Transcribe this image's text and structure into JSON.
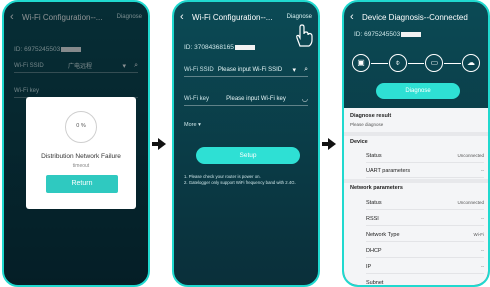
{
  "colors": {
    "accent": "#2ee0d4",
    "frame": "#20d9cf",
    "bg_dark": "#0a2f3a",
    "panel": "#f4f5f7"
  },
  "screen1": {
    "title": "Wi-Fi Configuration--...",
    "diagnose": "Diagnose",
    "device_id": "ID: 6975245503",
    "ssid_label": "Wi-Fi SSID",
    "ssid_value": "广电远程",
    "wifi_key_label": "Wi-Fi key",
    "modal": {
      "percent": "0 %",
      "message": "Distribution Network Failure",
      "sub": "timeout",
      "button": "Return"
    }
  },
  "screen2": {
    "title": "Wi-Fi Configuration--...",
    "diagnose": "Diagnose",
    "device_id": "ID: 37084368165",
    "ssid_label": "Wi-Fi SSID",
    "ssid_placeholder": "Please input Wi-Fi SSID",
    "key_label": "Wi-Fi key",
    "key_placeholder": "Please input Wi-Fi key",
    "more": "More",
    "setup": "Setup",
    "notes": [
      "1. Please check your router is power on.",
      "2. Gatelogger only support WiFi frequency band with 2.4G."
    ]
  },
  "screen3": {
    "title": "Device Diagnosis--Connected",
    "device_id": "ID: 6975245503",
    "diagnose_button": "Diagnose",
    "result_title": "Diagnose result",
    "result_sub": "Please diagnose",
    "device_section": "Device",
    "device_rows": [
      {
        "label": "Status",
        "value": "Unconnected"
      },
      {
        "label": "UART parameters",
        "value": "--"
      }
    ],
    "network_section": "Network parameters",
    "network_rows": [
      {
        "label": "Status",
        "value": "Unconnected"
      },
      {
        "label": "RSSI",
        "value": "--"
      },
      {
        "label": "Network Type",
        "value": "Wi-Fi"
      },
      {
        "label": "DHCP",
        "value": "--"
      },
      {
        "label": "IP",
        "value": "--"
      },
      {
        "label": "Subnet",
        "value": "--"
      }
    ]
  }
}
